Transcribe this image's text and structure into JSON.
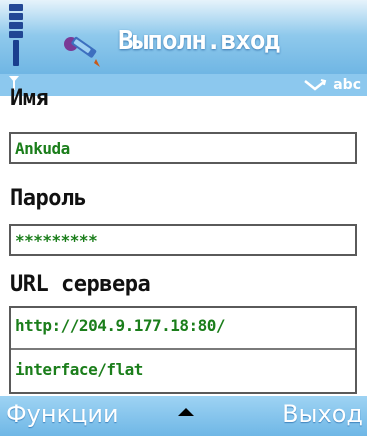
{
  "header": {
    "title": "Выполн.вход",
    "signal_icon": "signal-bars-icon",
    "app_icon": "pencil-key-icon"
  },
  "indicators": {
    "left_icon": "antenna-icon",
    "right_icon": "keypad-arrow-icon",
    "input_mode": "abc"
  },
  "form": {
    "name_label": "Имя",
    "name_value": "Ankuda",
    "password_label": "Пароль",
    "password_value": "*********",
    "server_url_label": "URL сервера",
    "server_url_line1": "http://204.9.177.18:80/",
    "server_url_line2": "interface/flat"
  },
  "softkeys": {
    "left": "Функции",
    "middle_icon": "up-arrow-icon",
    "right": "Выход"
  },
  "colors": {
    "title_bar": "#6cb4e3",
    "field_text": "#1b7e1b",
    "softkey_text": "#ffffff"
  }
}
